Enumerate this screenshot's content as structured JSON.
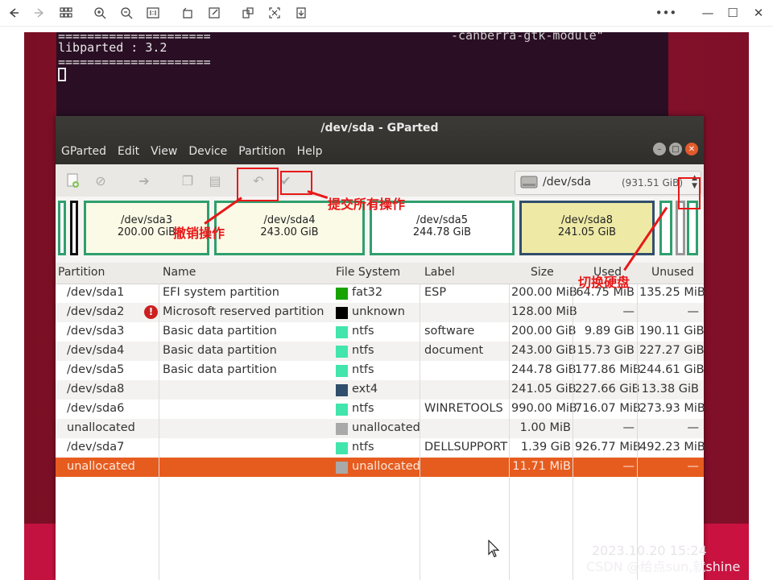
{
  "terminal": {
    "lines": [
      "=====================",
      "libparted : 3.2",
      "====================="
    ],
    "bg_text": "-canberra-gtk-module\""
  },
  "gparted": {
    "title": "/dev/sda - GParted",
    "menu": [
      "GParted",
      "Edit",
      "View",
      "Device",
      "Partition",
      "Help"
    ],
    "device": {
      "name": "/dev/sda",
      "size": "(931.51 GiB)"
    },
    "map": [
      {
        "name": "/dev/sda3",
        "size": "200.00 GiB"
      },
      {
        "name": "/dev/sda4",
        "size": "243.00 GiB"
      },
      {
        "name": "/dev/sda5",
        "size": "244.78 GiB"
      },
      {
        "name": "/dev/sda8",
        "size": "241.05 GiB"
      }
    ],
    "columns": [
      "Partition",
      "Name",
      "File System",
      "Label",
      "Size",
      "Used",
      "Unused"
    ],
    "rows": [
      {
        "partition": "/dev/sda1",
        "name": "EFI system partition",
        "fs": "fat32",
        "label": "ESP",
        "size": "200.00 MiB",
        "used": "64.75 MiB",
        "unused": "135.25 MiB"
      },
      {
        "partition": "/dev/sda2",
        "name": "Microsoft reserved partition",
        "fs": "unknown",
        "label": "",
        "size": "128.00 MiB",
        "used": "—",
        "unused": "—"
      },
      {
        "partition": "/dev/sda3",
        "name": "Basic data partition",
        "fs": "ntfs",
        "label": "software",
        "size": "200.00 GiB",
        "used": "9.89 GiB",
        "unused": "190.11 GiB"
      },
      {
        "partition": "/dev/sda4",
        "name": "Basic data partition",
        "fs": "ntfs",
        "label": "document",
        "size": "243.00 GiB",
        "used": "15.73 GiB",
        "unused": "227.27 GiB"
      },
      {
        "partition": "/dev/sda5",
        "name": "Basic data partition",
        "fs": "ntfs",
        "label": "",
        "size": "244.78 GiB",
        "used": "177.86 MiB",
        "unused": "244.61 GiB"
      },
      {
        "partition": "/dev/sda8",
        "name": "",
        "fs": "ext4",
        "label": "",
        "size": "241.05 GiB",
        "used": "227.66 GiB",
        "unused": "13.38 GiB"
      },
      {
        "partition": "/dev/sda6",
        "name": "",
        "fs": "ntfs",
        "label": "WINRETOOLS",
        "size": "990.00 MiB",
        "used": "716.07 MiB",
        "unused": "273.93 MiB"
      },
      {
        "partition": "unallocated",
        "name": "",
        "fs": "unallocated",
        "label": "",
        "size": "1.00 MiB",
        "used": "—",
        "unused": "—"
      },
      {
        "partition": "/dev/sda7",
        "name": "",
        "fs": "ntfs",
        "label": "DELLSUPPORT",
        "size": "1.39 GiB",
        "used": "926.77 MiB",
        "unused": "492.23 MiB"
      },
      {
        "partition": "unallocated",
        "name": "",
        "fs": "unallocated",
        "label": "",
        "size": "11.71 MiB",
        "used": "—",
        "unused": "—"
      }
    ],
    "fs_colors": {
      "fat32": "#18a303",
      "unknown": "#000000",
      "ntfs": "#42e5ac",
      "ext4": "#314e6c",
      "unallocated": "#a9a9a9"
    }
  },
  "annotations": {
    "undo": "撤销操作",
    "apply": "提交所有操作",
    "switch_disk": "切换硬盘"
  },
  "photo_overlay": {
    "timestamp": "2023.10.20  15:24",
    "watermark": "CSDN @给点sun,就shine"
  }
}
